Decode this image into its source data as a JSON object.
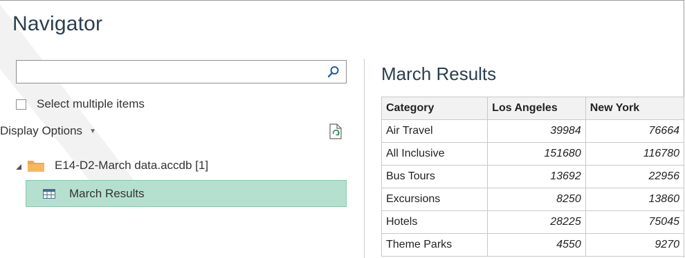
{
  "navigator": {
    "title": "Navigator",
    "search": {
      "value": "",
      "placeholder": ""
    },
    "select_multiple_label": "Select multiple items",
    "display_options_label": "Display Options",
    "tree": {
      "database_label": "E14-D2-March data.accdb [1]",
      "selected_item_label": "March Results"
    }
  },
  "preview": {
    "title": "March Results",
    "columns": [
      "Category",
      "Los Angeles",
      "New York"
    ],
    "rows": [
      [
        "Air Travel",
        "39984",
        "76664"
      ],
      [
        "All Inclusive",
        "151680",
        "116780"
      ],
      [
        "Bus Tours",
        "13692",
        "22956"
      ],
      [
        "Excursions",
        "8250",
        "13860"
      ],
      [
        "Hotels",
        "28225",
        "75045"
      ],
      [
        "Theme Parks",
        "4550",
        "9270"
      ]
    ]
  },
  "colors": {
    "selected_bg": "#b5e0d0",
    "folder": "#f0a64a",
    "title": "#2c3e50"
  },
  "icons": [
    "search-icon",
    "refresh-icon",
    "folder-icon",
    "table-icon",
    "expand-caret-icon",
    "dropdown-caret-icon"
  ]
}
